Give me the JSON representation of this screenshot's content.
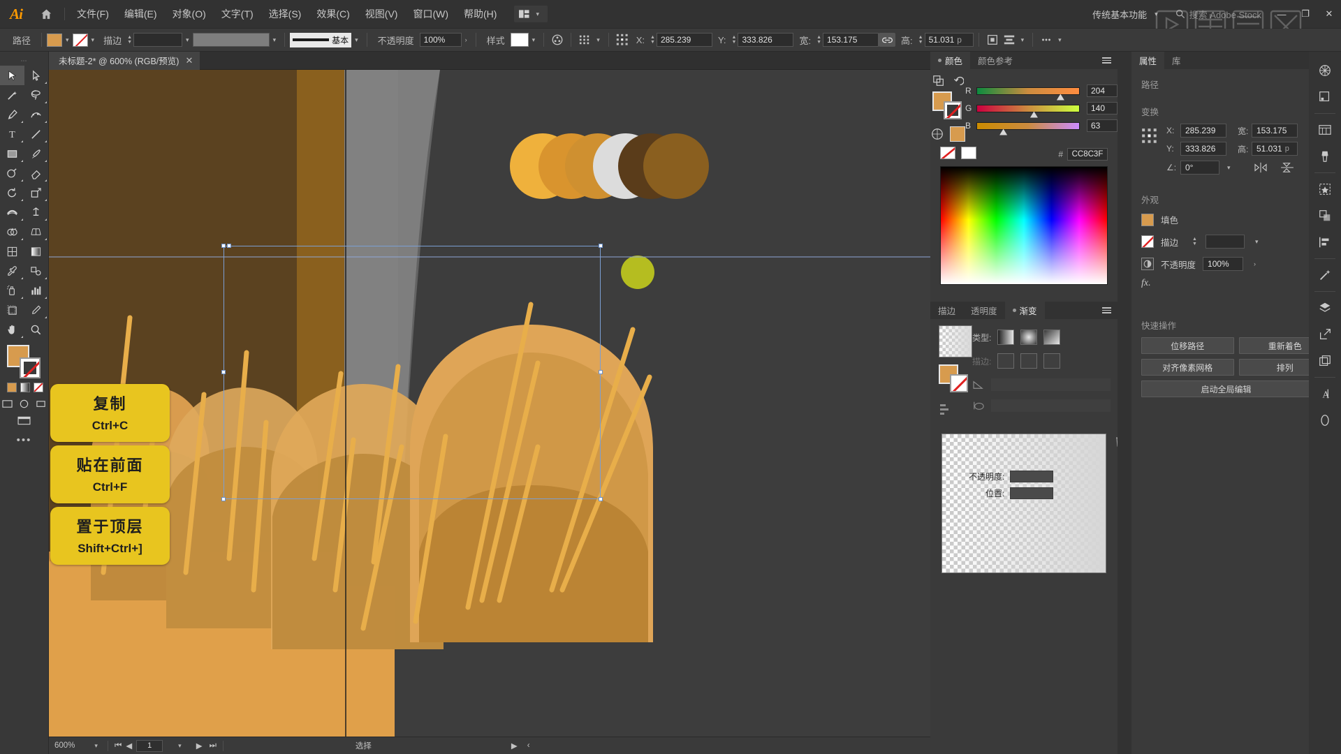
{
  "app": {
    "name": "Adobe Illustrator",
    "logo": "Ai"
  },
  "menubar": {
    "items": [
      "文件(F)",
      "编辑(E)",
      "对象(O)",
      "文字(T)",
      "选择(S)",
      "效果(C)",
      "视图(V)",
      "窗口(W)",
      "帮助(H)"
    ],
    "workspace": "传统基本功能",
    "search_placeholder": "搜索 Adobe Stock",
    "window_buttons": [
      "—",
      "❐",
      "✕"
    ]
  },
  "controlbar": {
    "path_label": "路径",
    "stroke_label": "描边",
    "stroke_weight": "",
    "brush_label": "基本",
    "opacity_label": "不透明度",
    "opacity_value": "100%",
    "style_label": "样式",
    "x_label": "X:",
    "x_value": "285.239",
    "y_label": "Y:",
    "y_value": "333.826",
    "w_label": "宽:",
    "w_value": "153.175",
    "h_label": "高:",
    "h_value": "51.031",
    "h_unit": "p"
  },
  "toolbar": {
    "tools": [
      "selection-tool",
      "direct-selection-tool",
      "magic-wand-tool",
      "lasso-tool",
      "pen-tool",
      "curvature-tool",
      "type-tool",
      "line-segment-tool",
      "rectangle-tool",
      "paintbrush-tool",
      "shaper-tool",
      "eraser-tool",
      "rotate-tool",
      "scale-tool",
      "width-tool",
      "free-transform-tool",
      "shape-builder-tool",
      "perspective-grid-tool",
      "mesh-tool",
      "gradient-tool",
      "eyedropper-tool",
      "blend-tool",
      "symbol-sprayer-tool",
      "column-graph-tool",
      "artboard-tool",
      "slice-tool",
      "hand-tool",
      "zoom-tool"
    ],
    "fill_color": "#d79b4e",
    "stroke_color": "none"
  },
  "document": {
    "tab_title": "未标题-2* @ 600% (RGB/预览)",
    "zoom": "600%",
    "page": "1",
    "status_tool": "选择"
  },
  "callouts": [
    {
      "title": "复制",
      "shortcut": "Ctrl+C"
    },
    {
      "title": "贴在前面",
      "shortcut": "Ctrl+F"
    },
    {
      "title": "置于顶层",
      "shortcut": "Shift+Ctrl+]"
    }
  ],
  "artwork": {
    "background": "#3d3d3d",
    "wall_dark": "#5e4420",
    "wall_mid": "#8a601e",
    "gray_shape": "#8d8d8d",
    "gray_shape_2": "#6d6d6d",
    "stalk_color": "#e8ae4a",
    "wheat_light": "#d99c4e",
    "wheat_mid": "#c98f42",
    "wheat_dark": "#b07c33",
    "floor": "#e2a24a",
    "swatch_circles": [
      "#efb13c",
      "#d9942e",
      "#cf9030",
      "#dcdcdc",
      "#5a3c1a",
      "#8a5f1f"
    ],
    "olive_circle": "#b5bd20"
  },
  "color_panel": {
    "tabs": [
      "颜色",
      "颜色参考"
    ],
    "active_tab": "颜色",
    "channels": [
      {
        "label": "R",
        "value": "204",
        "pos": 80
      },
      {
        "label": "G",
        "value": "140",
        "pos": 55
      },
      {
        "label": "B",
        "value": "63",
        "pos": 25
      }
    ],
    "hex_symbol": "#",
    "hex_value": "CC8C3F",
    "current_fill": "#cc8c3f"
  },
  "gradient_panel": {
    "tabs": [
      "描边",
      "透明度",
      "渐变"
    ],
    "active_tab": "渐变",
    "type_label": "类型:",
    "stroke_label": "描边:",
    "angle_label": "",
    "opacity_label": "不透明度:",
    "position_label": "位置:",
    "opacity_value": "",
    "position_value": ""
  },
  "properties_panel": {
    "tabs": [
      "属性",
      "库"
    ],
    "active_tab": "属性",
    "section_path": "路径",
    "section_transform": "变换",
    "x_label": "X:",
    "x_value": "285.239",
    "y_label": "Y:",
    "y_value": "333.826",
    "w_label": "宽:",
    "w_value": "153.175",
    "h_label": "高:",
    "h_value": "51.031",
    "h_unit": "p",
    "angle_label": "∠:",
    "angle_value": "0°",
    "section_appearance": "外观",
    "fill_label": "填色",
    "stroke_label": "描边",
    "opacity_label": "不透明度",
    "opacity_value": "100%",
    "fx_label": "fx.",
    "section_quick": "快速操作",
    "quick_actions": [
      "位移路径",
      "重新着色",
      "对齐像素网格",
      "排列",
      "启动全局编辑"
    ],
    "dots": "•••"
  },
  "icon_rail": {
    "items": [
      "color-panel-icon",
      "swatches-icon",
      "artboards-icon",
      "brushes-icon",
      "symbols-icon",
      "pathfinder-icon",
      "align-icon",
      "magic-wand-icon",
      "layers-icon",
      "export-icon",
      "asset-export-icon",
      "character-icon",
      "glyphs-icon"
    ]
  }
}
